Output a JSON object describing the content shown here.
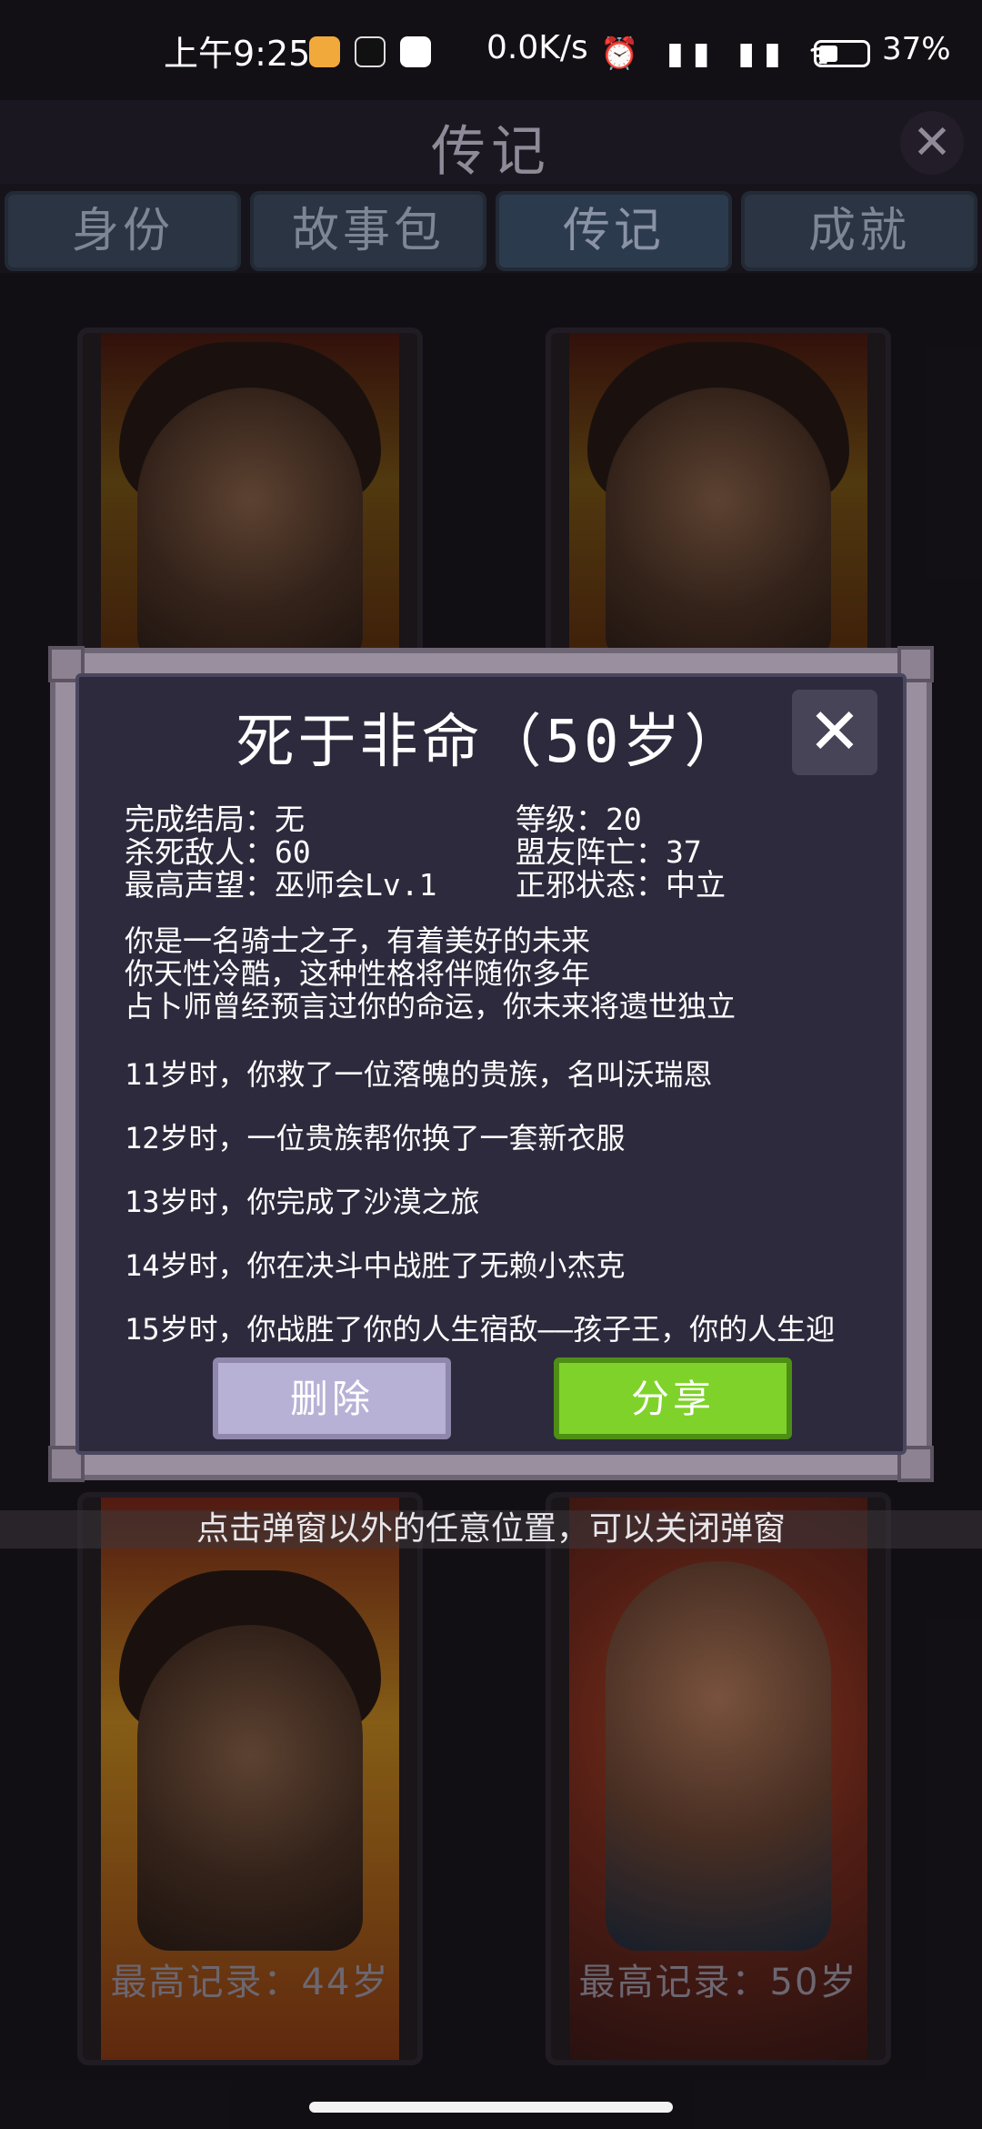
{
  "status_bar": {
    "time": "上午9:25",
    "network_speed": "0.0K/s",
    "signal": "HD ıll HD ıll",
    "battery": "37%"
  },
  "header": {
    "title": "传记",
    "close_icon": "close-icon"
  },
  "tabs": [
    {
      "label": "身份",
      "active": false
    },
    {
      "label": "故事包",
      "active": false
    },
    {
      "label": "传记",
      "active": true
    },
    {
      "label": "成就",
      "active": false
    }
  ],
  "cards": [
    {
      "record": ""
    },
    {
      "record": ""
    },
    {
      "record": "最高记录：44岁"
    },
    {
      "record": "最高记录：50岁"
    }
  ],
  "hint": "点击弹窗以外的任意位置，可以关闭弹窗",
  "modal": {
    "title": "死于非命（50岁）",
    "stats": [
      "完成结局：无",
      "等级：20",
      "杀死敌人：60",
      "盟友阵亡：37",
      "最高声望：巫师会Lv.1",
      "正邪状态：中立"
    ],
    "story": [
      "你是一名骑士之子，有着美好的未来",
      "你天性冷酷，这种性格将伴随你多年",
      "占卜师曾经预言过你的命运，你未来将遗世独立"
    ],
    "events": [
      "11岁时，你救了一位落魄的贵族，名叫沃瑞恩",
      "12岁时，一位贵族帮你换了一套新衣服",
      "13岁时，你完成了沙漠之旅",
      "14岁时，你在决斗中战胜了无赖小杰克",
      "15岁时，你战胜了你的人生宿敌——孩子王，你的人生迎"
    ],
    "delete_label": "删除",
    "share_label": "分享"
  },
  "colors": {
    "share_button": "#7fd22a",
    "delete_button": "#b8b1d6",
    "modal_background": "#2d2a3d"
  }
}
